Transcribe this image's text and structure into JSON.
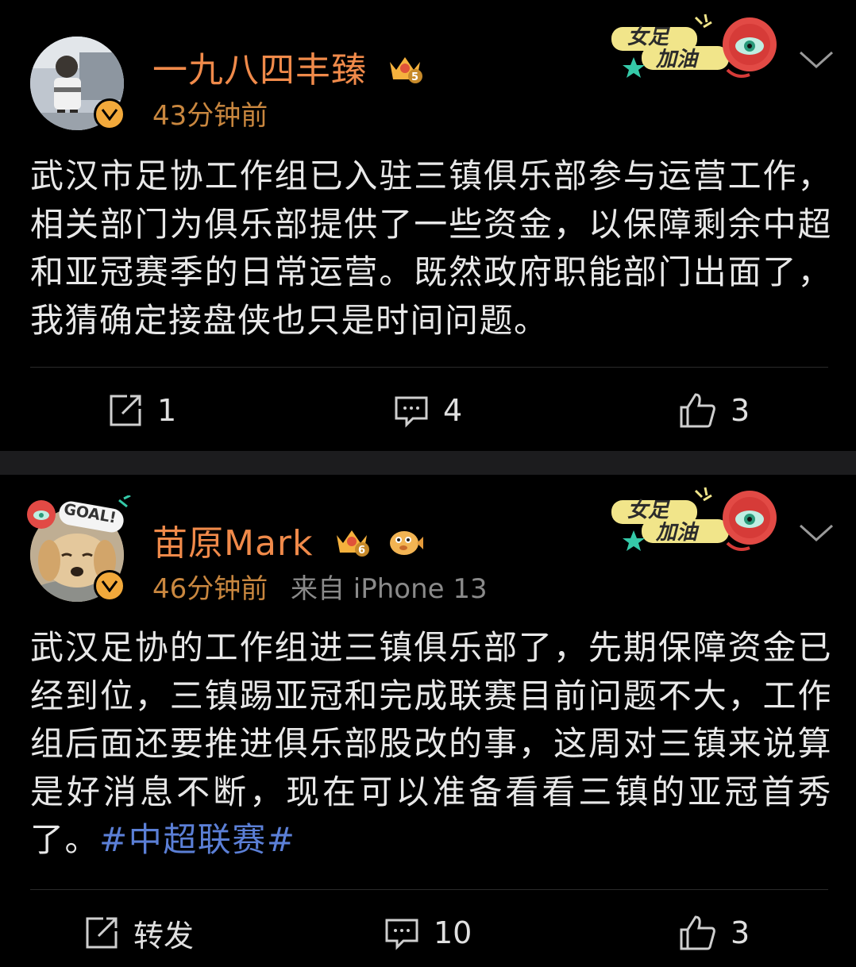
{
  "colors": {
    "background": "#000000",
    "separator": "#1c1c1e",
    "username": "#f08a4a",
    "timestamp": "#c9873f",
    "source": "#8a8a8a",
    "hashtag": "#5b7fd6",
    "text": "#e8e8e8"
  },
  "posts": [
    {
      "username": "一九八四丰臻",
      "badge": "crown-level-5-icon",
      "time": "43分钟前",
      "source": "",
      "content": "武汉市足协工作组已入驻三镇俱乐部参与运营工作，相关部门为俱乐部提供了一些资金，以保障剩余中超和亚冠赛季的日常运营。既然政府职能部门出面了，我猜确定接盘侠也只是时间问题。",
      "hashtag": "",
      "sticker": {
        "line1": "女足",
        "line2": "加油"
      },
      "actions": {
        "repost": "1",
        "comment": "4",
        "like": "3"
      }
    },
    {
      "username": "苗原Mark",
      "badge": "crown-level-6-icon",
      "time": "46分钟前",
      "source": "来自 iPhone 13",
      "content": "武汉足协的工作组进三镇俱乐部了，先期保障资金已经到位，三镇踢亚冠和完成联赛目前问题不大，工作组后面还要推进俱乐部股改的事，这周对三镇来说算是好消息不断，现在可以准备看看三镇的亚冠首秀了。",
      "hashtag": "#中超联赛#",
      "avatar_frame_text": "GOAL!",
      "sticker": {
        "line1": "女足",
        "line2": "加油"
      },
      "actions": {
        "repost": "转发",
        "comment": "10",
        "like": "3"
      }
    }
  ]
}
